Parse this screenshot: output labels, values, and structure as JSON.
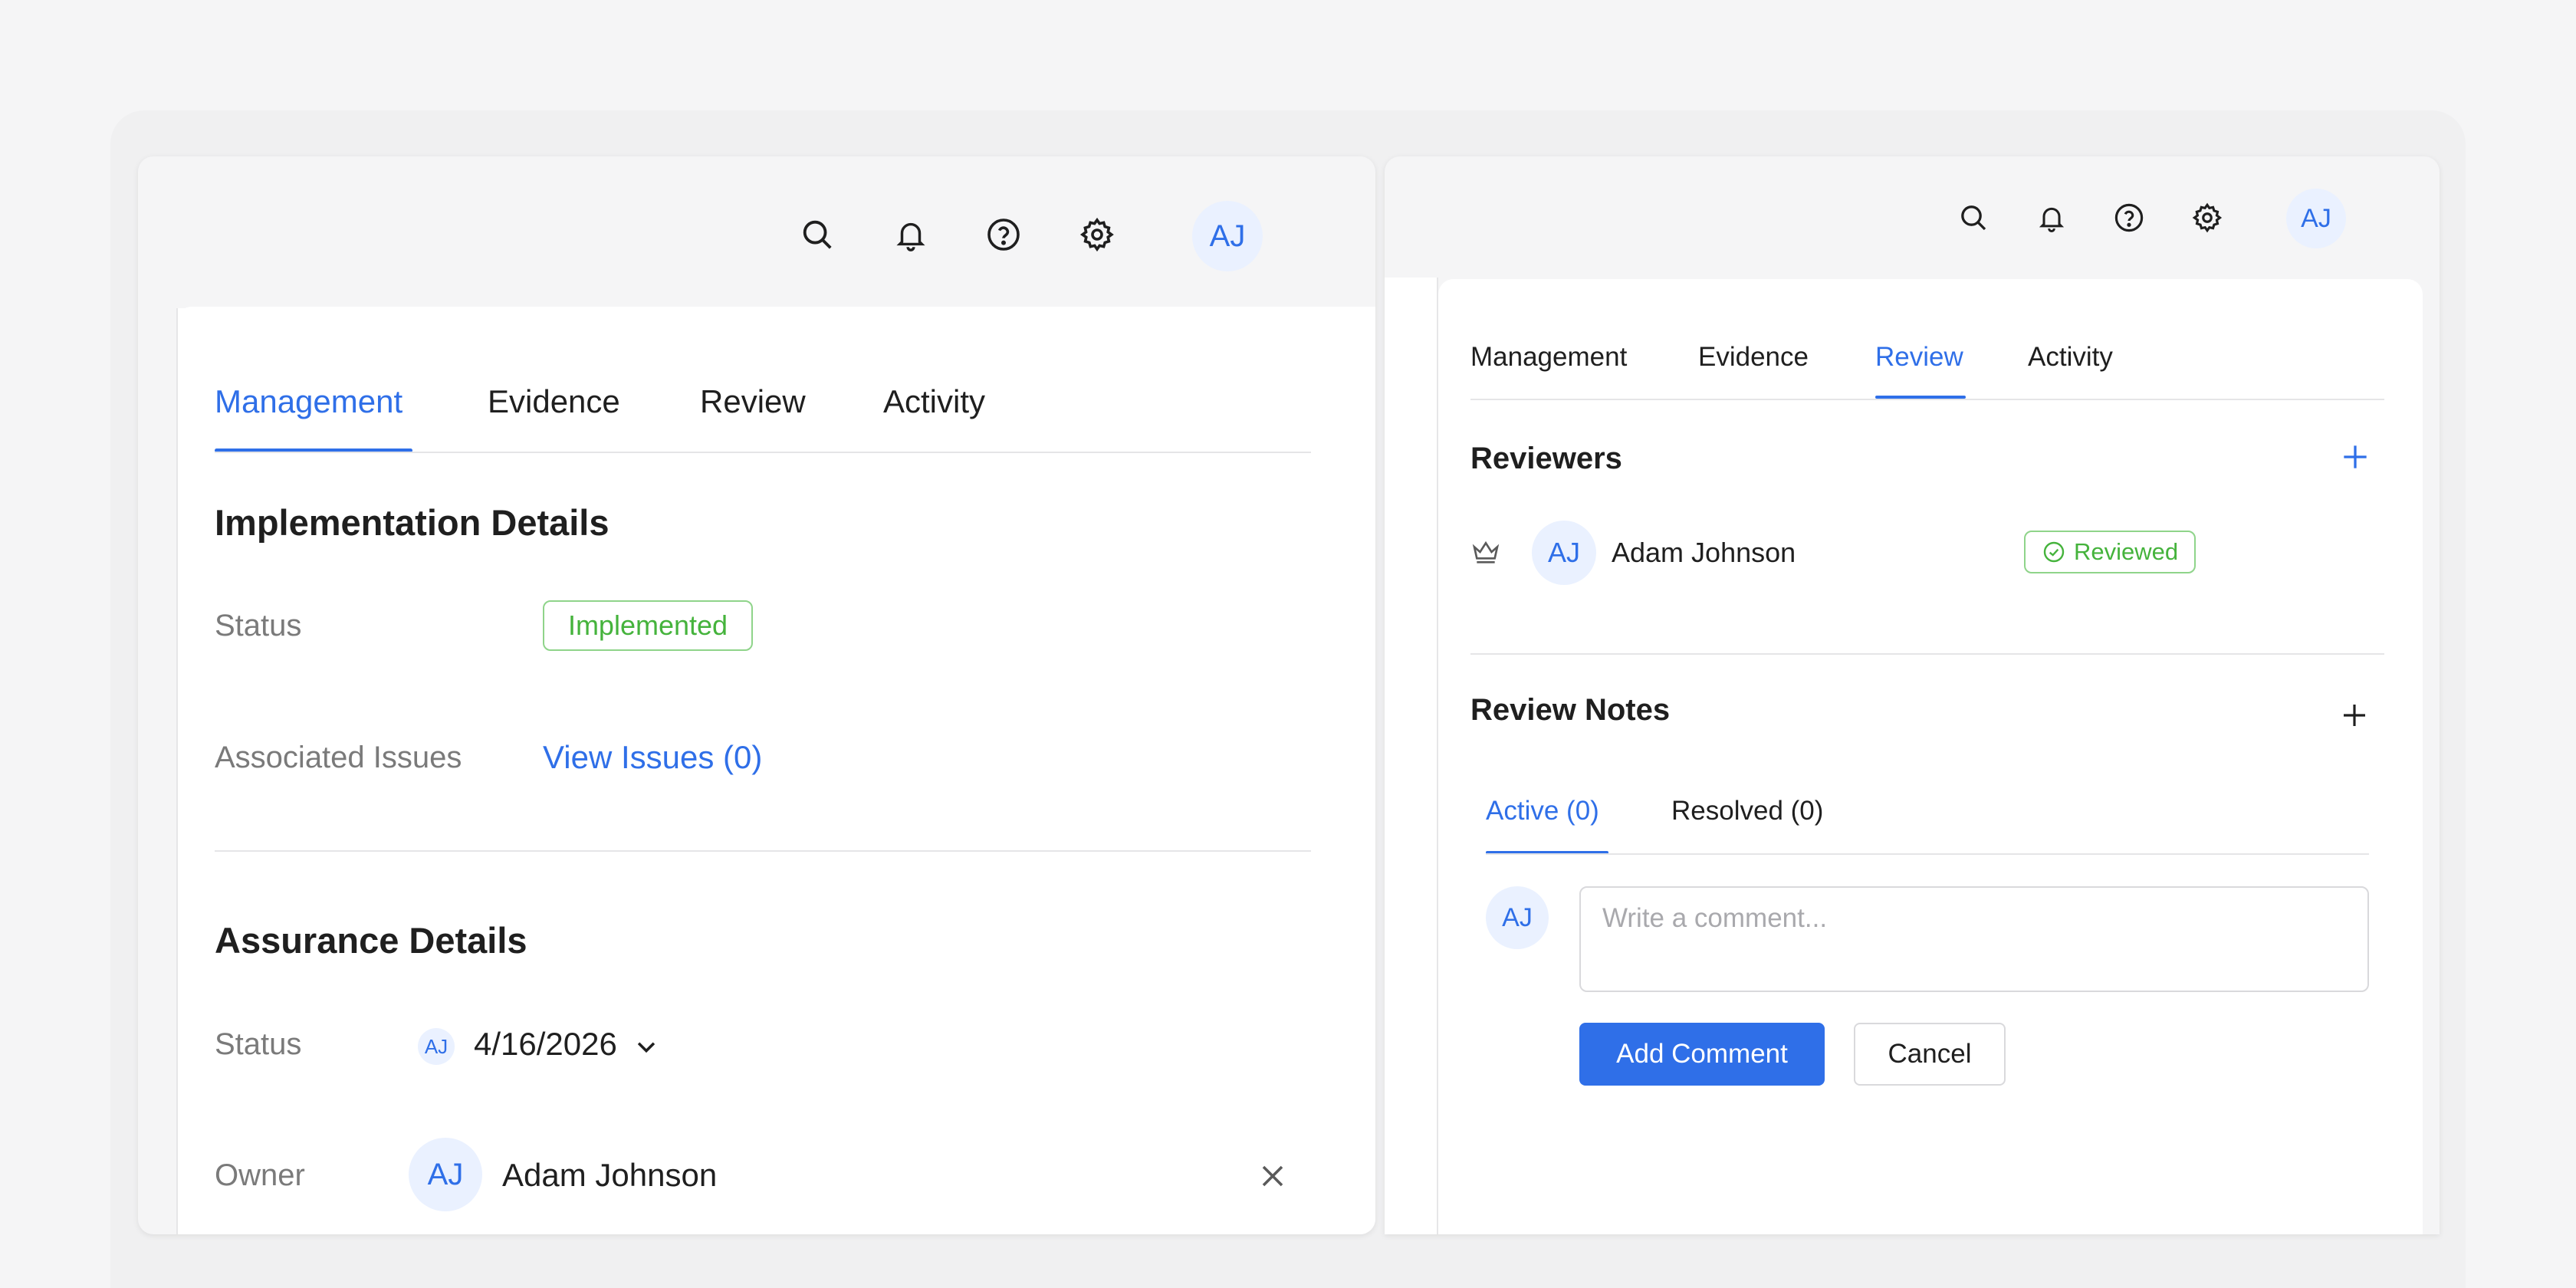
{
  "user": {
    "initials": "AJ",
    "name": "Adam Johnson"
  },
  "left": {
    "tabs": [
      "Management",
      "Evidence",
      "Review",
      "Activity"
    ],
    "active_tab": "Management",
    "implementation": {
      "title": "Implementation Details",
      "status_label": "Status",
      "status_value": "Implemented",
      "issues_label": "Associated Issues",
      "issues_link": "View Issues (0)"
    },
    "assurance": {
      "title": "Assurance Details",
      "status_label": "Status",
      "status_initials": "AJ",
      "status_date": "4/16/2026",
      "owner_label": "Owner",
      "owner_initials": "AJ",
      "owner_name": "Adam Johnson"
    }
  },
  "right": {
    "tabs": [
      "Management",
      "Evidence",
      "Review",
      "Activity"
    ],
    "active_tab": "Review",
    "reviewers": {
      "title": "Reviewers",
      "add": "+",
      "items": [
        {
          "initials": "AJ",
          "name": "Adam Johnson",
          "status": "Reviewed"
        }
      ]
    },
    "notes": {
      "title": "Review Notes",
      "add": "+",
      "tabs": [
        "Active (0)",
        "Resolved (0)"
      ],
      "active_tab": "Active (0)",
      "comment_initials": "AJ",
      "comment_placeholder": "Write a comment...",
      "add_button": "Add Comment",
      "cancel_button": "Cancel"
    }
  },
  "colors": {
    "accent": "#2f6fe8",
    "success": "#45b33c",
    "avatar_bg": "#eaf1ff"
  },
  "icons": [
    "search-icon",
    "bell-icon",
    "help-icon",
    "gear-icon",
    "crown-icon",
    "check-circle-icon",
    "close-icon",
    "chevron-down-icon",
    "plus-icon"
  ]
}
